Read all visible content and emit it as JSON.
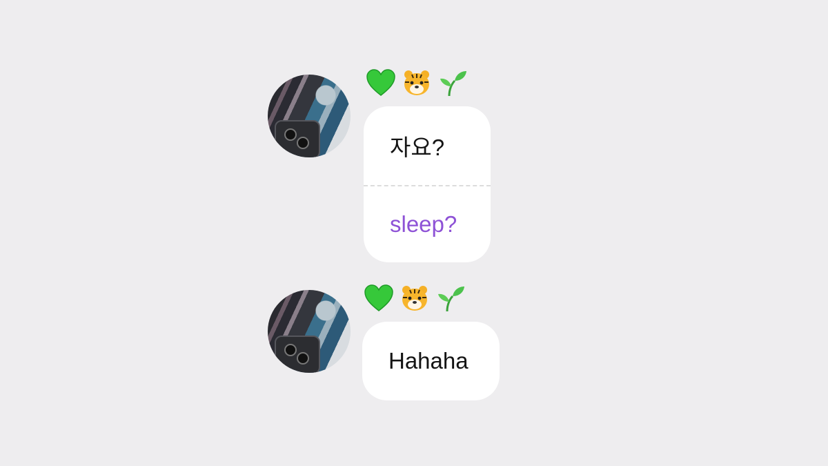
{
  "messages": [
    {
      "emojis": [
        "green-heart",
        "tiger-face",
        "seedling"
      ],
      "text": "자요?",
      "translation": "sleep?"
    },
    {
      "emojis": [
        "green-heart",
        "tiger-face",
        "seedling"
      ],
      "text": "Hahaha"
    }
  ],
  "colors": {
    "background": "#eeedef",
    "bubble": "#ffffff",
    "translation": "#8e52d6",
    "text": "#141414"
  }
}
